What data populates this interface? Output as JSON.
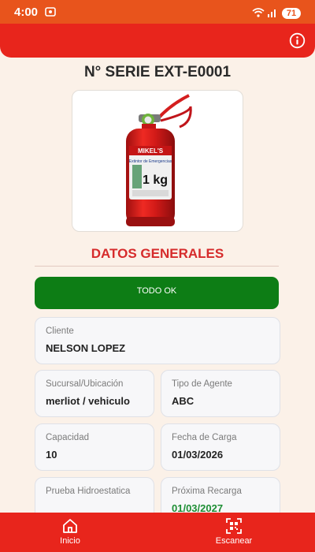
{
  "status_bar": {
    "time": "4:00",
    "battery": "71"
  },
  "page": {
    "title": "N° SERIE EXT-E0001"
  },
  "product": {
    "brand": "MIKEL'S",
    "label_line": "Extintor de Emergencias",
    "capacity_text": "1 kg"
  },
  "section": {
    "title": "DATOS GENERALES"
  },
  "status_button": {
    "label": "TODO OK"
  },
  "fields": {
    "cliente": {
      "label": "Cliente",
      "value": "NELSON LOPEZ"
    },
    "sucursal": {
      "label": "Sucursal/Ubicación",
      "value": "merliot / vehiculo"
    },
    "tipo_agente": {
      "label": "Tipo de Agente",
      "value": "ABC"
    },
    "capacidad": {
      "label": "Capacidad",
      "value": "10"
    },
    "fecha_carga": {
      "label": "Fecha de Carga",
      "value": "01/03/2026"
    },
    "prueba_hidro": {
      "label": "Prueba Hidroestatica",
      "value": ""
    },
    "proxima_recarga": {
      "label": "Próxima Recarga",
      "value": "01/03/2027"
    }
  },
  "nav": {
    "home_label": "Inicio",
    "scan_label": "Escanear"
  },
  "colors": {
    "header_red": "#E8251C",
    "status_bar_orange": "#E8541C",
    "ok_green": "#0D7D15",
    "section_red": "#D62B2B",
    "date_green": "#1D8E34",
    "background": "#FBF1E8"
  },
  "icons": {
    "info": "info-circle-icon",
    "home": "home-icon",
    "scan": "qr-scan-icon",
    "wifi": "wifi-icon",
    "signal": "signal-icon",
    "screen_record": "screen-record-icon"
  }
}
